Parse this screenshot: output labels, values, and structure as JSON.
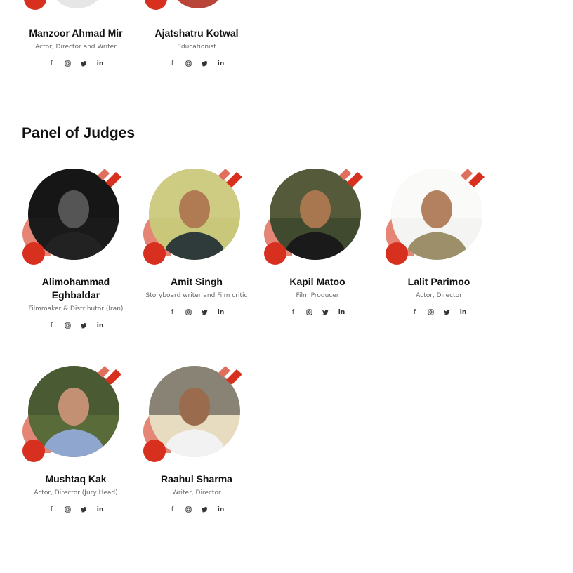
{
  "previous_panel": [
    {
      "name": "Manzoor Ahmad Mir",
      "role": "Actor, Director and Writer"
    },
    {
      "name": "Ajatshatru Kotwal",
      "role": "Educationist"
    }
  ],
  "section": {
    "title": "Panel of Judges"
  },
  "judges": [
    {
      "name": "Alimohammad Eghbaldar",
      "role": "Filmmaker & Distributor (Iran)"
    },
    {
      "name": "Amit Singh",
      "role": "Storyboard writer and Film critic"
    },
    {
      "name": "Kapil Matoo",
      "role": "Film Producer"
    },
    {
      "name": "Lalit Parimoo",
      "role": "Actor, Director"
    },
    {
      "name": "Mushtaq Kak",
      "role": "Actor, Director (Jury Head)"
    },
    {
      "name": "Raahul Sharma",
      "role": "Writer, Director"
    }
  ],
  "social_icons": [
    "facebook-icon",
    "instagram-icon",
    "twitter-icon",
    "linkedin-icon"
  ],
  "colors": {
    "accent": "#d8301f",
    "accent_light": "#e0705e"
  }
}
